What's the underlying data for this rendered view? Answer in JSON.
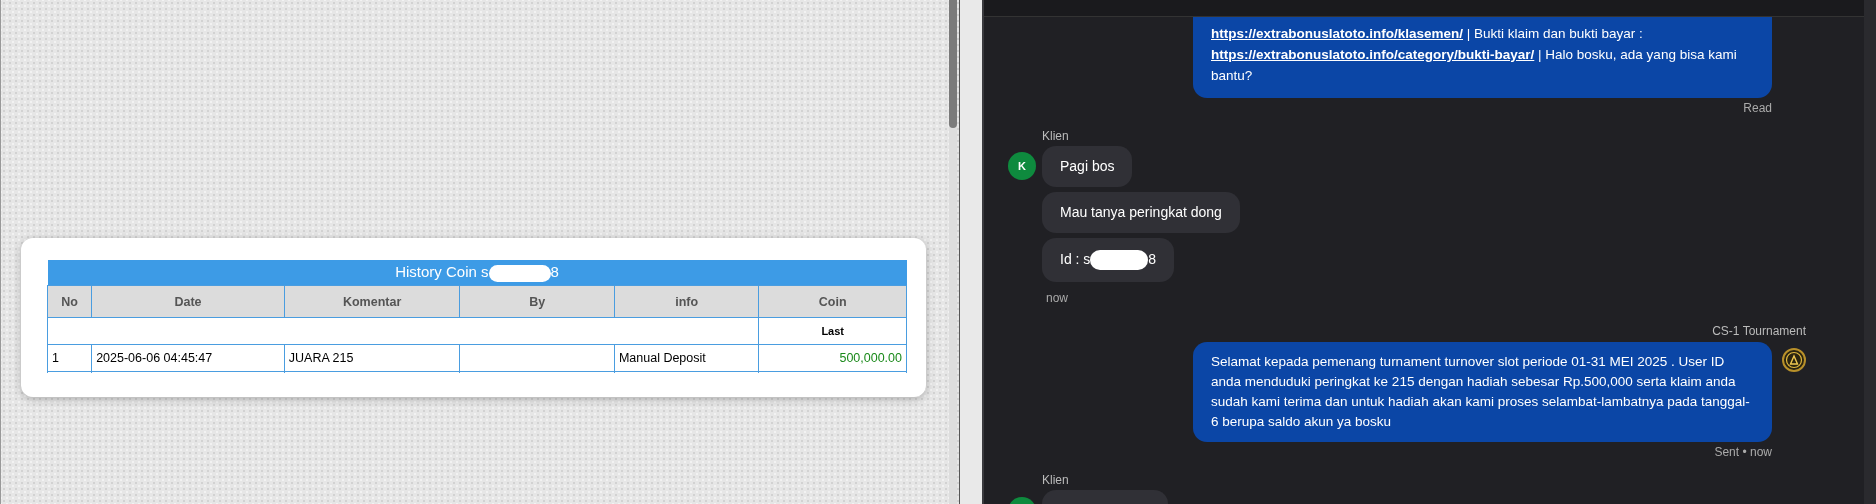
{
  "history": {
    "title_start": "History Coin s",
    "title_redacted": true,
    "title_end": "8",
    "columns": [
      "No",
      "Date",
      "Komentar",
      "By",
      "info",
      "Coin"
    ],
    "subheader": "Last",
    "rows": [
      {
        "no": "1",
        "date": "2025-06-06 04:45:47",
        "komentar": "JUARA 215",
        "info": "Manual Deposit",
        "coin": "500,000.00"
      }
    ]
  },
  "chat": {
    "messages": [
      {
        "kind": "outgoing",
        "parts": [
          {
            "kind": "link",
            "text": "https://extrabonuslatoto.info/klasemen/"
          },
          {
            "kind": "text",
            "text": " | Bukti klaim dan bukti bayar : "
          },
          {
            "kind": "link",
            "text": "https://extrabonuslatoto.info/category/bukti-bayar/"
          },
          {
            "kind": "text",
            "text": " | Halo bosku, ada yang bisa kami bantu?"
          }
        ],
        "status": "Read"
      },
      {
        "kind": "incoming",
        "sender": "Klien",
        "avatar": "K",
        "bubbles": [
          {
            "text_start": "Pagi bos"
          },
          {
            "text_start": "Mau tanya peringkat dong"
          },
          {
            "text_start": "Id : s",
            "redacted": true,
            "text_end": "8"
          }
        ],
        "time": "now"
      },
      {
        "kind": "outgoing",
        "sender": "CS-1 Tournament",
        "parts": [
          {
            "kind": "text",
            "text": "Selamat kepada pemenang turnament turnover slot periode 01-31 MEI 2025 . User ID anda menduduki peringkat ke 215 dengan hadiah sebesar Rp.500,000 serta klaim anda sudah kami terima dan untuk hadiah akan kami proses selambat-lambatnya pada tanggal- 6 berupa saldo akun ya bosku"
          }
        ],
        "status": "Sent • now"
      },
      {
        "kind": "incoming",
        "sender": "Klien"
      }
    ]
  }
}
